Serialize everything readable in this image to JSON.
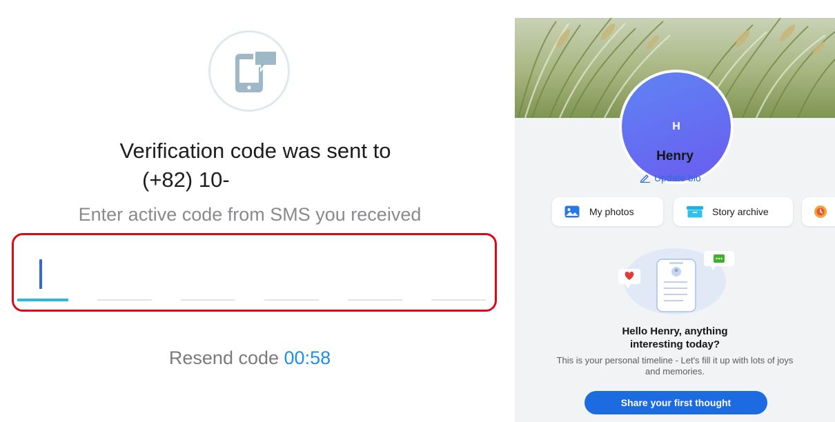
{
  "verification": {
    "icon": "phone-message-icon",
    "title_line1": "Verification code was sent to",
    "title_line2": "(+82) 10-",
    "subtitle": "Enter active code from SMS you received",
    "code_digits": [
      "",
      "",
      "",
      "",
      "",
      ""
    ],
    "resend_label": "Resend code",
    "resend_timer": "00:58",
    "colors": {
      "highlight_border": "#e00613",
      "active_underline": "#27b8e5",
      "timer": "#1f8fe6"
    }
  },
  "profile": {
    "avatar_initial": "H",
    "name": "Henry",
    "update_bio": "Update bio",
    "quick_actions": [
      {
        "label": "My photos",
        "icon": "photos-icon"
      },
      {
        "label": "Story archive",
        "icon": "archive-icon"
      },
      {
        "label": "",
        "icon": "memories-clock-icon"
      }
    ],
    "empty_state": {
      "title": "Hello Henry, anything interesting today?",
      "description": "This is your personal timeline - Let's fill it up with lots of joys and memories.",
      "cta": "Share your first thought"
    },
    "colors": {
      "cta": "#1d6be0",
      "link": "#2f6ad8"
    }
  }
}
